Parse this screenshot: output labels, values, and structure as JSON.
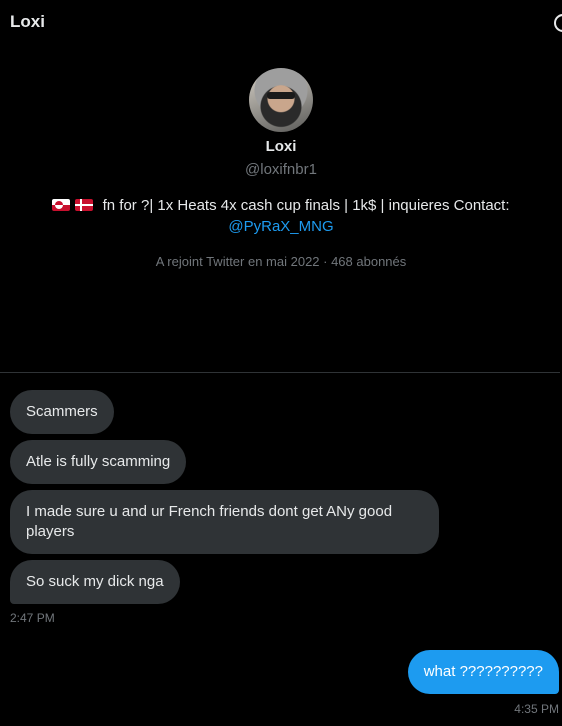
{
  "header": {
    "title": "Loxi",
    "info_icon": "info-circle-icon"
  },
  "profile": {
    "avatar_icon": "avatar-image",
    "name": "Loxi",
    "handle": "@loxifnbr1",
    "bio_flags": [
      "greenland-flag-icon",
      "denmark-flag-icon"
    ],
    "bio_text": "fn for ?| 1x Heats 4x cash cup finals | 1k$ | inquieres Contact:",
    "bio_link": "@PyRaX_MNG",
    "joined": "A rejoint Twitter en mai 2022 · 468 abonnés"
  },
  "messages": {
    "incoming": [
      {
        "text": "Scammers"
      },
      {
        "text": "Atle is fully scamming"
      },
      {
        "text": "I made sure u and ur French friends dont get ANy good players"
      },
      {
        "text": "So suck my dick nga"
      }
    ],
    "incoming_time": "2:47 PM",
    "outgoing": [
      {
        "text": "what ??????????"
      }
    ],
    "outgoing_time": "4:35 PM"
  },
  "colors": {
    "background": "#000000",
    "incoming_bubble": "#2f3336",
    "outgoing_bubble": "#1d9bf0",
    "link": "#1d9bf0",
    "muted_text": "#71767b"
  }
}
